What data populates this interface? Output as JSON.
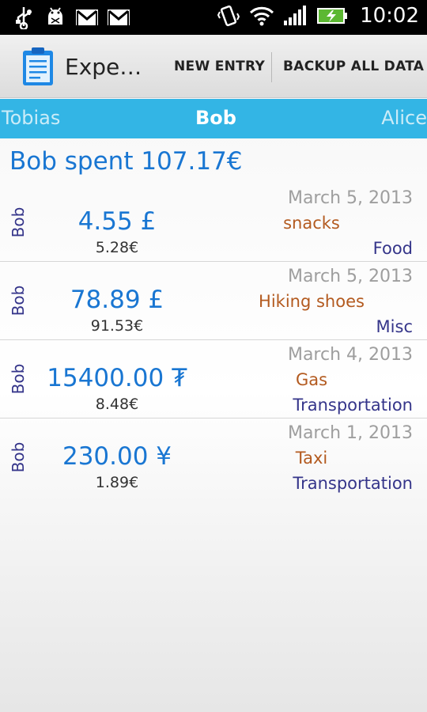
{
  "status_bar": {
    "time": "10:02",
    "left_icons": [
      "usb-icon",
      "android-debug-icon",
      "gmail-icon",
      "gmail-icon"
    ],
    "right_icons": [
      "vibrate-icon",
      "wifi-icon",
      "signal-icon",
      "battery-charging-icon"
    ]
  },
  "action_bar": {
    "title": "Expe…",
    "new_entry": "NEW ENTRY",
    "backup": "BACKUP ALL DATA"
  },
  "tabs": {
    "left": "Tobias",
    "center": "Bob",
    "right": "Alice"
  },
  "summary": "Bob spent 107.17€",
  "entries": [
    {
      "person": "Bob",
      "amount": "4.55 £",
      "converted": "5.28€",
      "date": "March 5, 2013",
      "description": "snacks",
      "category": "Food"
    },
    {
      "person": "Bob",
      "amount": "78.89 £",
      "converted": "91.53€",
      "date": "March 5, 2013",
      "description": "Hiking shoes",
      "category": "Misc"
    },
    {
      "person": "Bob",
      "amount": "15400.00 ₮",
      "converted": "8.48€",
      "date": "March 4, 2013",
      "description": "Gas",
      "category": "Transportation"
    },
    {
      "person": "Bob",
      "amount": "230.00 ¥",
      "converted": "1.89€",
      "date": "March 1, 2013",
      "description": "Taxi",
      "category": "Transportation"
    }
  ],
  "colors": {
    "tab_bar": "#33b5e5",
    "amount": "#1976d2",
    "description": "#b35a1f",
    "category": "#35358a"
  }
}
